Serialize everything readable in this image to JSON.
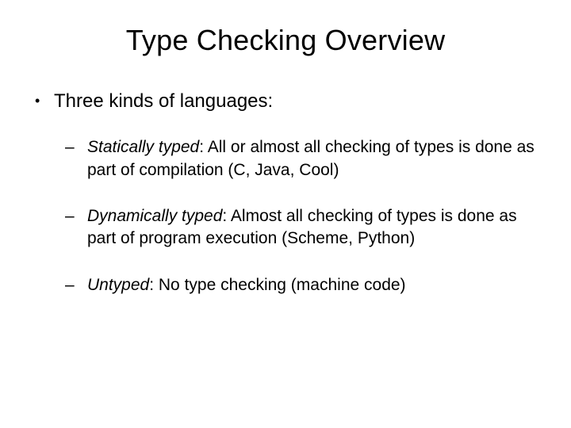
{
  "title": "Type Checking Overview",
  "intro": "Three kinds of languages:",
  "items": [
    {
      "term": "Statically typed",
      "desc": ": All or almost all checking of types is done as part of compilation (C, Java, Cool)"
    },
    {
      "term": "Dynamically typed",
      "desc": ": Almost all checking of types is done as part of program execution (Scheme, Python)"
    },
    {
      "term": "Untyped",
      "desc": ": No type checking (machine code)"
    }
  ]
}
